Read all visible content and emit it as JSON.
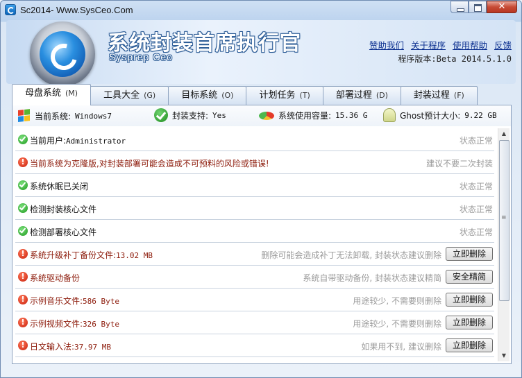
{
  "window": {
    "title": "Sc2014- Www.SysCeo.Com",
    "close_glyph": "✕"
  },
  "banner": {
    "app_name": "系统封装首席执行官",
    "app_sub": "Sysprep Ceo",
    "links": [
      "赞助我们",
      "关于程序",
      "使用帮助",
      "反馈"
    ],
    "version": "程序版本:Beta 2014.5.1.0"
  },
  "tabs": [
    {
      "label": "母盘系统",
      "key": "(M)"
    },
    {
      "label": "工具大全",
      "key": "(G)"
    },
    {
      "label": "目标系统",
      "key": "(O)"
    },
    {
      "label": "计划任务",
      "key": "(T)"
    },
    {
      "label": "部署过程",
      "key": "(D)"
    },
    {
      "label": "封装过程",
      "key": "(F)"
    }
  ],
  "sysinfo": {
    "current_os_label": "当前系统:",
    "current_os": "Windows7",
    "support_label": "封装支持:",
    "support": "Yes",
    "usage_label": "系统使用容量:",
    "usage": "15.36 G",
    "ghost_label": "Ghost预计大小:",
    "ghost": "9.22 GB"
  },
  "rows": [
    {
      "status": "ok",
      "text": "当前用户:",
      "mono": "Administrator",
      "note": "状态正常",
      "button": ""
    },
    {
      "status": "warn",
      "text": "当前系统为克隆版,对封装部署可能会造成不可预料的风险或错误!",
      "mono": "",
      "note": "建议不要二次封装",
      "button": ""
    },
    {
      "status": "ok",
      "text": "系统休眠已关闭",
      "mono": "",
      "note": "状态正常",
      "button": ""
    },
    {
      "status": "ok",
      "text": "检测封装核心文件",
      "mono": "",
      "note": "状态正常",
      "button": ""
    },
    {
      "status": "ok",
      "text": "检测部署核心文件",
      "mono": "",
      "note": "状态正常",
      "button": ""
    },
    {
      "status": "warn",
      "text": "系统升级补丁备份文件:",
      "mono": "13.02 MB",
      "note": "删除可能会造成补丁无法卸载, 封装状态建议删除",
      "button": "立即删除"
    },
    {
      "status": "warn",
      "text": "系统驱动备份",
      "mono": "",
      "note": "系统自带驱动备份, 封装状态建议精简",
      "button": "安全精简"
    },
    {
      "status": "warn",
      "text": "示例音乐文件:",
      "mono": "586 Byte",
      "note": "用途较少, 不需要则删除",
      "button": "立即删除"
    },
    {
      "status": "warn",
      "text": "示例视频文件:",
      "mono": "326 Byte",
      "note": "用途较少, 不需要则删除",
      "button": "立即删除"
    },
    {
      "status": "warn",
      "text": "日文输入法:",
      "mono": "37.97 MB",
      "note": "如果用不到, 建议删除",
      "button": "立即删除"
    }
  ],
  "colors": {
    "accent": "#2a8fe0",
    "warn": "#c81e0a",
    "ok": "#1f9a1f"
  }
}
